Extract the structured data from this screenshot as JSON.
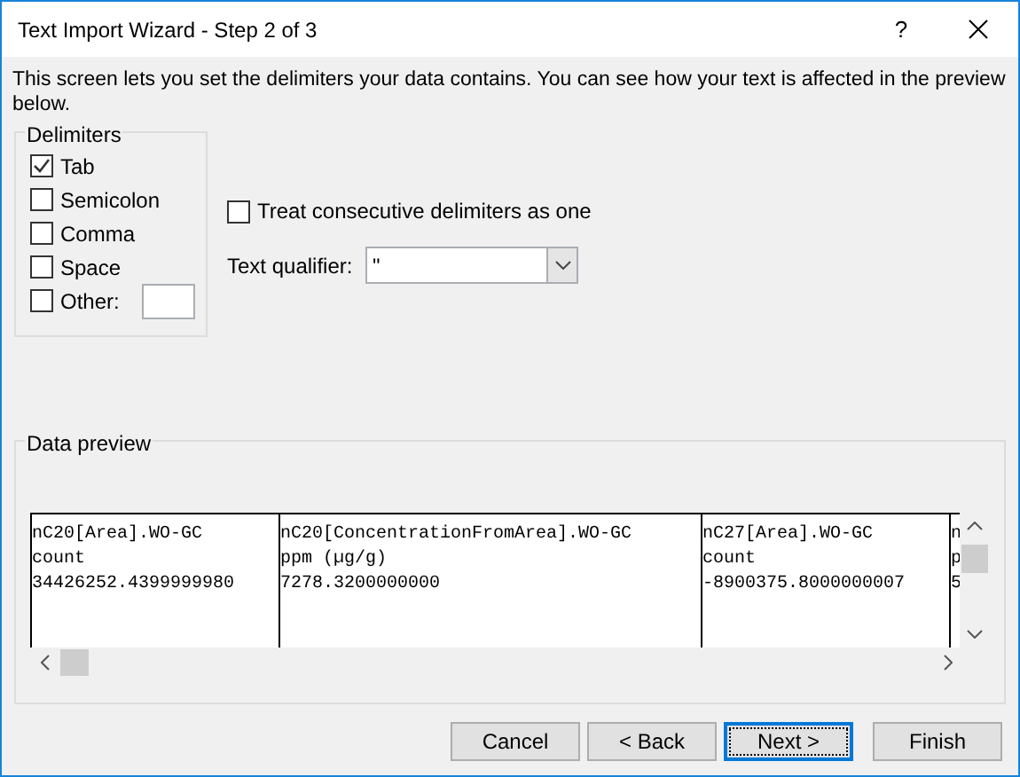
{
  "window": {
    "title": "Text Import Wizard - Step 2 of 3",
    "help": "?"
  },
  "description": "This screen lets you set the delimiters your data contains.  You can see how your text is affected in the preview below.",
  "delimiters": {
    "title": "Delimiters",
    "options": [
      {
        "label": "Tab",
        "checked": true
      },
      {
        "label": "Semicolon",
        "checked": false
      },
      {
        "label": "Comma",
        "checked": false
      },
      {
        "label": "Space",
        "checked": false
      },
      {
        "label": "Other:",
        "checked": false,
        "kind": "other"
      }
    ]
  },
  "consecutive": {
    "label": "Treat consecutive delimiters as one",
    "checked": false
  },
  "text_qualifier": {
    "label": "Text qualifier:",
    "value": "\""
  },
  "data_preview": {
    "title": "Data preview",
    "columns": [
      {
        "lines": [
          "nC20[Area].WO-GC",
          "count",
          "34426252.4399999980"
        ]
      },
      {
        "lines": [
          "nC20[ConcentrationFromArea].WO-GC",
          "ppm (µg/g)",
          "7278.3200000000"
        ]
      },
      {
        "lines": [
          "nC27[Area].WO-GC",
          "count",
          "-8900375.8000000007"
        ]
      },
      {
        "lines": [
          "n",
          "p",
          "5"
        ]
      }
    ]
  },
  "buttons": [
    {
      "label": "Cancel",
      "selected": false
    },
    {
      "label": "< Back",
      "selected": false
    },
    {
      "label": "Next >",
      "selected": true
    },
    {
      "label": "Finish",
      "selected": false
    }
  ]
}
